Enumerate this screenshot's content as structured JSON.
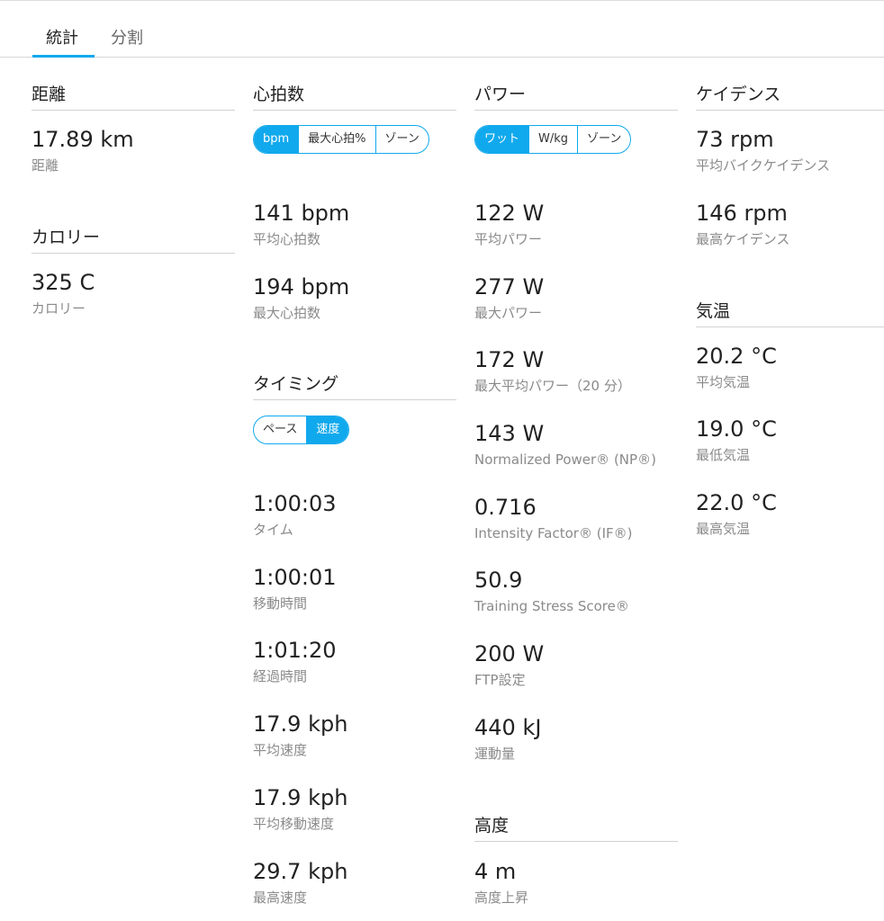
{
  "tabs": {
    "stats": "統計",
    "laps": "分割"
  },
  "accent_color": "#11a9ed",
  "distance": {
    "title": "距離",
    "stats": [
      {
        "value": "17.89 km",
        "label": "距離"
      }
    ]
  },
  "calories": {
    "title": "カロリー",
    "stats": [
      {
        "value": "325 C",
        "label": "カロリー"
      }
    ]
  },
  "heart_rate": {
    "title": "心拍数",
    "toggle": [
      "bpm",
      "最大心拍%",
      "ゾーン"
    ],
    "active_toggle": "bpm",
    "stats": [
      {
        "value": "141 bpm",
        "label": "平均心拍数"
      },
      {
        "value": "194 bpm",
        "label": "最大心拍数"
      }
    ]
  },
  "timing": {
    "title": "タイミング",
    "toggle": [
      "ペース",
      "速度"
    ],
    "active_toggle": "速度",
    "stats": [
      {
        "value": "1:00:03",
        "label": "タイム"
      },
      {
        "value": "1:00:01",
        "label": "移動時間"
      },
      {
        "value": "1:01:20",
        "label": "経過時間"
      },
      {
        "value": "17.9 kph",
        "label": "平均速度"
      },
      {
        "value": "17.9 kph",
        "label": "平均移動速度"
      },
      {
        "value": "29.7 kph",
        "label": "最高速度"
      }
    ]
  },
  "power": {
    "title": "パワー",
    "toggle": [
      "ワット",
      "W/kg",
      "ゾーン"
    ],
    "active_toggle": "ワット",
    "stats": [
      {
        "value": "122 W",
        "label": "平均パワー"
      },
      {
        "value": "277 W",
        "label": "最大パワー"
      },
      {
        "value": "172 W",
        "label": "最大平均パワー（20 分）"
      },
      {
        "value": "143 W",
        "label": "Normalized Power® (NP®)"
      },
      {
        "value": "0.716",
        "label": "Intensity Factor® (IF®)"
      },
      {
        "value": "50.9",
        "label": "Training Stress Score®"
      },
      {
        "value": "200 W",
        "label": "FTP設定"
      },
      {
        "value": "440 kJ",
        "label": "運動量"
      }
    ]
  },
  "elevation": {
    "title": "高度",
    "stats": [
      {
        "value": "4 m",
        "label": "高度上昇"
      }
    ]
  },
  "cadence": {
    "title": "ケイデンス",
    "stats": [
      {
        "value": "73 rpm",
        "label": "平均バイクケイデンス"
      },
      {
        "value": "146 rpm",
        "label": "最高ケイデンス"
      }
    ]
  },
  "temperature": {
    "title": "気温",
    "stats": [
      {
        "value": "20.2 °C",
        "label": "平均気温"
      },
      {
        "value": "19.0 °C",
        "label": "最低気温"
      },
      {
        "value": "22.0 °C",
        "label": "最高気温"
      }
    ]
  }
}
